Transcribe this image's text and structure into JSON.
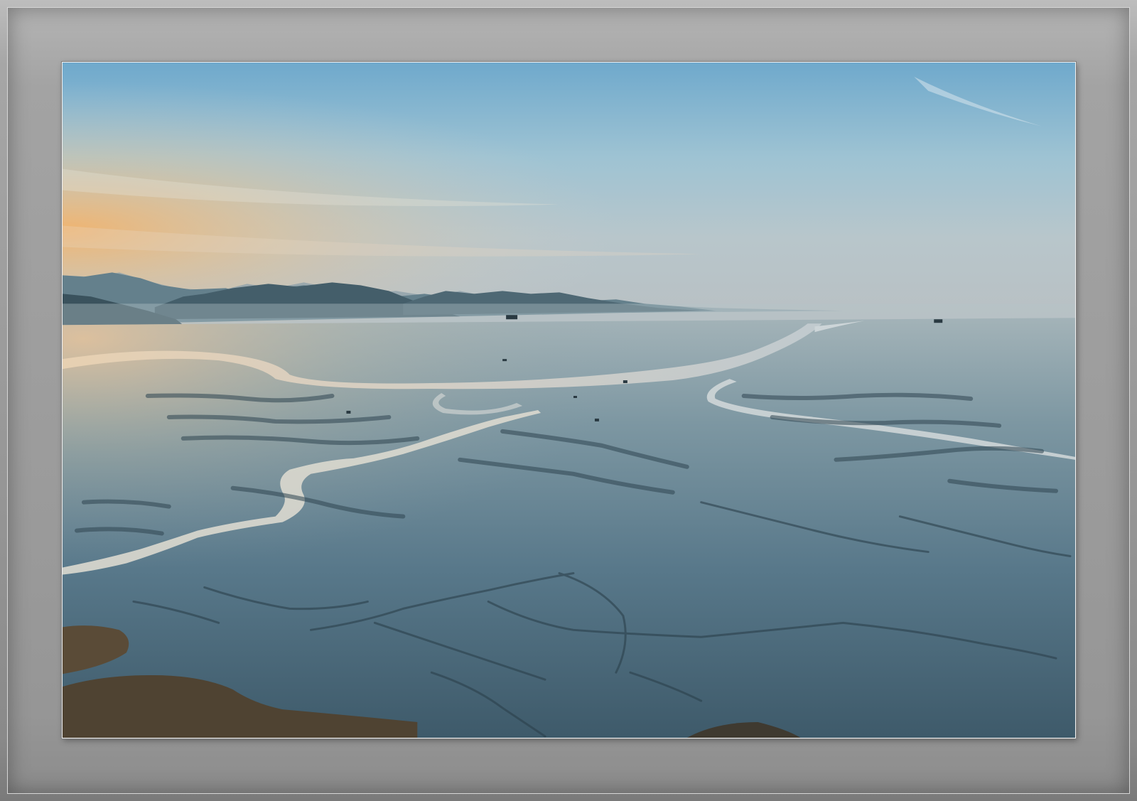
{
  "scene": {
    "description_colors": {
      "sky_top": "#6ea9cc",
      "sky_mid": "#a9c6d2",
      "sunset_glow": "#e8b47a",
      "mountain_dark": "#3d5560",
      "mountain_far": "#6f8a96",
      "tidal_flat": "#5f7e8c",
      "tidal_dark": "#2f4752",
      "channel_light": "#d8d6cc",
      "reeds": "#5b4b36",
      "frame_gray": "#9d9d9d"
    }
  }
}
